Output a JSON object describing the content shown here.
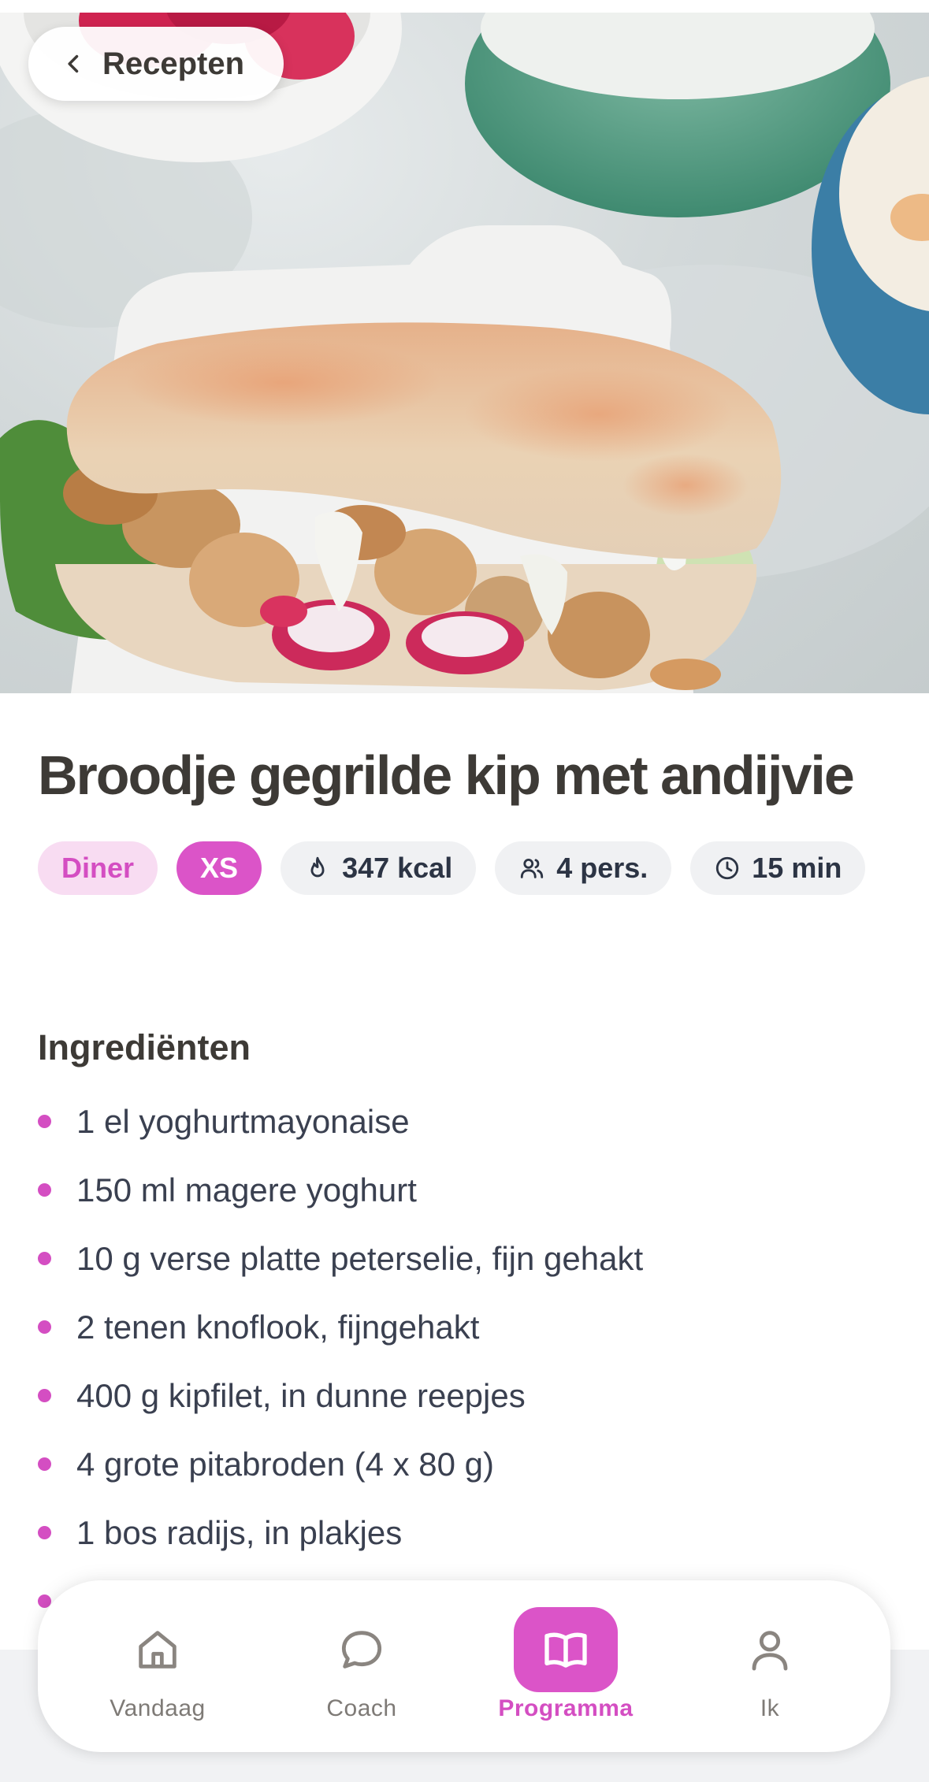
{
  "header": {
    "back_label": "Recepten"
  },
  "recipe": {
    "title": "Broodje gegrilde kip met andijvie",
    "tags": {
      "meal": "Diner",
      "size": "XS",
      "kcal": "347 kcal",
      "persons": "4 pers.",
      "time": "15 min"
    },
    "ingredients_title": "Ingrediënten",
    "ingredients": [
      "1 el yoghurtmayonaise",
      "150 ml magere yoghurt",
      "10 g verse platte peterselie, fijn gehakt",
      "2 tenen knoflook, fijngehakt",
      "400 g kipfilet, in dunne reepjes",
      "4 grote pitabroden (4 x 80 g)",
      "1 bos radijs, in plakjes",
      ""
    ]
  },
  "nav": {
    "items": [
      {
        "label": "Vandaag",
        "icon": "home-icon"
      },
      {
        "label": "Coach",
        "icon": "chat-bubble-icon"
      },
      {
        "label": "Programma",
        "icon": "book-open-icon",
        "active": true
      },
      {
        "label": "Ik",
        "icon": "user-icon"
      }
    ]
  },
  "colors": {
    "accent": "#db54c8",
    "accent_light": "#f8dcf2",
    "title_text": "#3d3a36",
    "body_text": "#3a4050",
    "chip_bg": "#f0f1f3"
  }
}
